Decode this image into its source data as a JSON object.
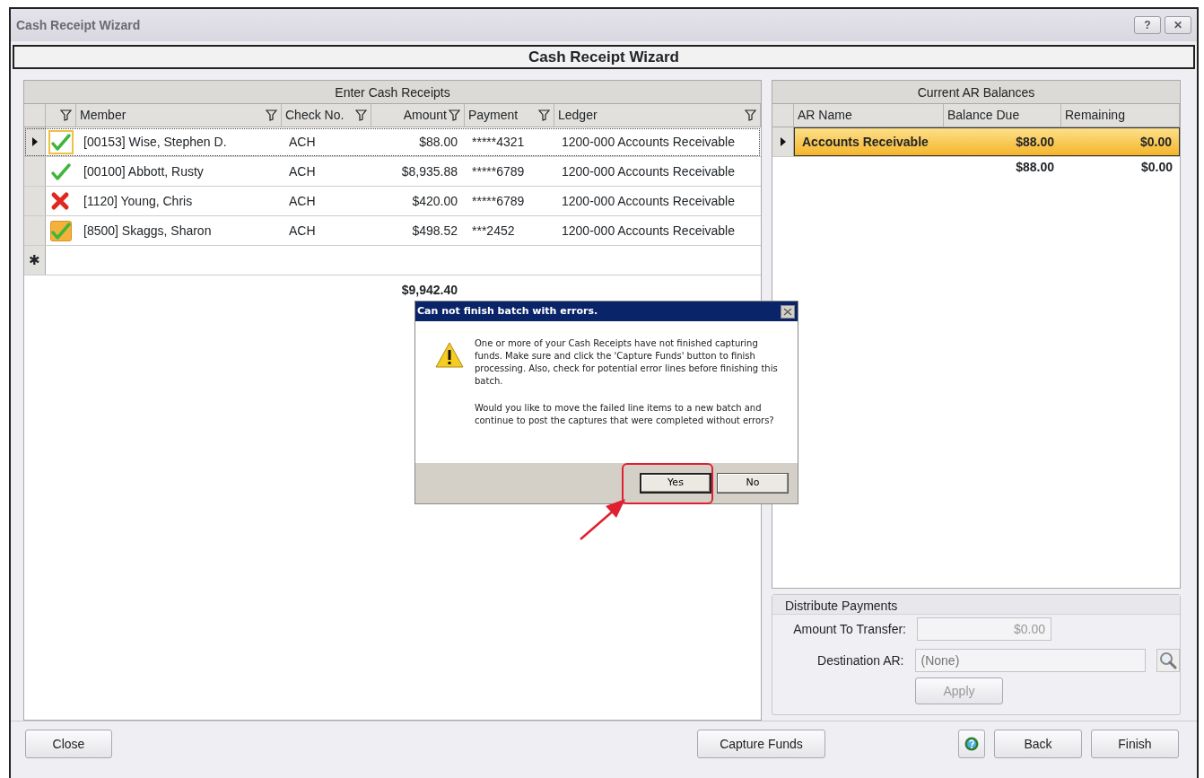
{
  "window": {
    "title": "Cash Receipt Wizard",
    "help_button": "?",
    "close_button": "✕"
  },
  "header": "Cash Receipt Wizard",
  "receipts": {
    "title": "Enter Cash Receipts",
    "status_filter": true,
    "columns": [
      {
        "label": "Member",
        "filter": true
      },
      {
        "label": "Check No.",
        "filter": true
      },
      {
        "label": "Amount",
        "filter": true
      },
      {
        "label": "Payment",
        "filter": true
      },
      {
        "label": "Ledger",
        "filter": true
      }
    ],
    "rows": [
      {
        "current": true,
        "kind": "check",
        "cells": [
          "[00153] Wise, Stephen D.",
          "ACH",
          "$88.00",
          "*****4321",
          "1200-000 Accounts Receivable"
        ]
      },
      {
        "current": false,
        "kind": "check",
        "cells": [
          "[00100] Abbott, Rusty",
          "ACH",
          "$8,935.88",
          "*****6789",
          "1200-000 Accounts Receivable"
        ]
      },
      {
        "current": false,
        "kind": "cross",
        "cells": [
          "[1120] Young, Chris",
          "ACH",
          "$420.00",
          "*****6789",
          "1200-000 Accounts Receivable"
        ]
      },
      {
        "current": false,
        "kind": "flagged",
        "cells": [
          "[8500] Skaggs, Sharon",
          "ACH",
          "$498.52",
          "***2452",
          "1200-000 Accounts Receivable"
        ]
      }
    ],
    "new_row_marker": "✱",
    "total": "$9,942.40"
  },
  "ar_balances": {
    "title": "Current AR Balances",
    "columns": [
      "AR Name",
      "Balance Due",
      "Remaining"
    ],
    "rows": [
      {
        "current": true,
        "cells": [
          "Accounts Receivable",
          "$88.00",
          "$0.00"
        ]
      }
    ],
    "totals": {
      "balance_due": "$88.00",
      "remaining": "$0.00"
    }
  },
  "distribute": {
    "title": "Distribute Payments",
    "amount_label": "Amount To Transfer:",
    "amount_value": "$0.00",
    "destination_label": "Destination AR:",
    "destination_placeholder": "(None)",
    "apply_button": "Apply",
    "disabled": true
  },
  "dialog": {
    "title": "Can not finish batch with errors.",
    "message": "One or more of your Cash Receipts have not finished capturing funds. Make sure and click the 'Capture Funds' button to finish processing. Also, check for potential error lines before finishing this batch.",
    "question": "Would you like to move the failed line items to a new batch and continue to post the captures that were completed without errors?",
    "buttons": [
      {
        "label": "Yes",
        "highlighted": true
      },
      {
        "label": "No",
        "highlighted": false
      }
    ]
  },
  "footer": {
    "close_button": "Close",
    "capture_button": "Capture Funds",
    "back_button": "Back",
    "finish_button": "Finish"
  }
}
